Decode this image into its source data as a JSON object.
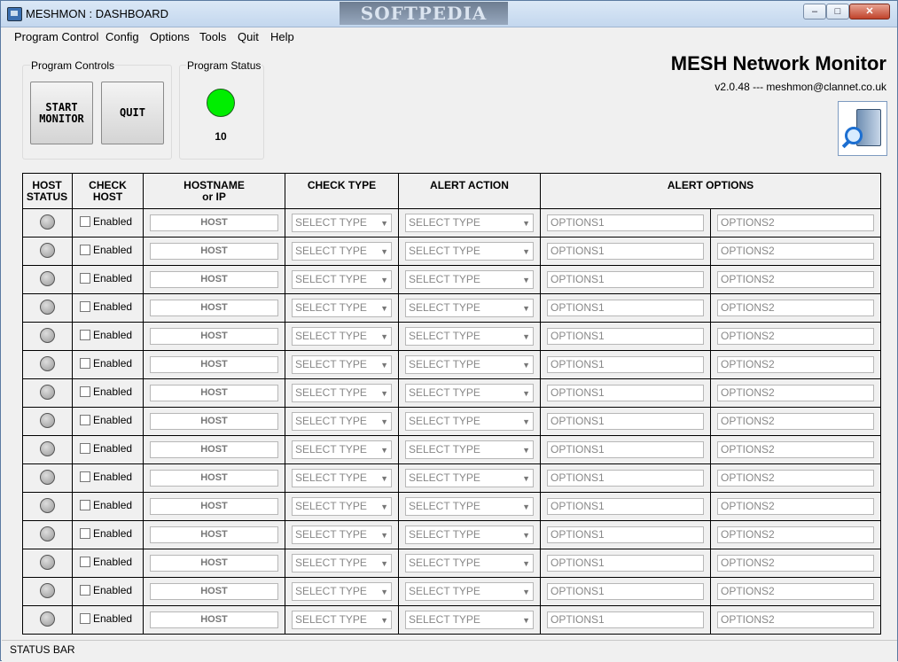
{
  "window": {
    "title": "MESHMON : DASHBOARD",
    "watermark": "SOFTPEDIA"
  },
  "menu": [
    "Program Control",
    "Config",
    "Options",
    "Tools",
    "Quit",
    "Help"
  ],
  "controls": {
    "group_label": "Program Controls",
    "start_label": "START\nMONITOR",
    "quit_label": "QUIT"
  },
  "status": {
    "group_label": "Program Status",
    "count": "10",
    "led_color": "#00ee00"
  },
  "header": {
    "title": "MESH Network Monitor",
    "version": "v2.0.48 --- meshmon@clannet.co.uk"
  },
  "grid": {
    "headers": [
      "HOST\nSTATUS",
      "CHECK\nHOST",
      "HOSTNAME\nor IP",
      "CHECK TYPE",
      "ALERT ACTION",
      "ALERT OPTIONS"
    ],
    "row_template": {
      "enabled_label": "Enabled",
      "host": "HOST",
      "check_type": "SELECT TYPE",
      "alert_action": "SELECT TYPE",
      "options1": "OPTIONS1",
      "options2": "OPTIONS2"
    },
    "row_count": 15
  },
  "statusbar": {
    "text": "STATUS BAR"
  }
}
